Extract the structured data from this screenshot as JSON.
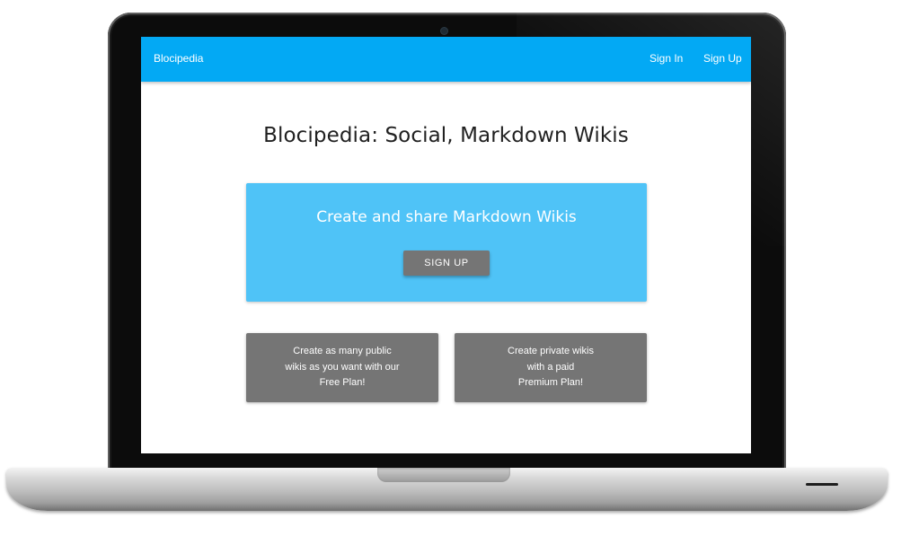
{
  "navbar": {
    "brand": "Blocipedia",
    "links": [
      {
        "label": "Sign In"
      },
      {
        "label": "Sign Up"
      }
    ]
  },
  "main": {
    "headline": "Blocipedia: Social, Markdown Wikis",
    "hero": {
      "title": "Create and share Markdown Wikis",
      "button_label": "SIGN UP"
    },
    "features": [
      {
        "lines": [
          "Create as many public",
          "wikis as you want with our",
          "Free Plan!"
        ]
      },
      {
        "lines": [
          "Create private wikis",
          "with a paid",
          "Premium Plan!"
        ]
      }
    ]
  },
  "colors": {
    "navbar": "#03a9f4",
    "hero": "#4fc3f7",
    "button": "#757575",
    "feature_card": "#757575",
    "headline_text": "#212121"
  },
  "icons": {
    "device": "laptop-mockup",
    "camera": "webcam-icon"
  }
}
